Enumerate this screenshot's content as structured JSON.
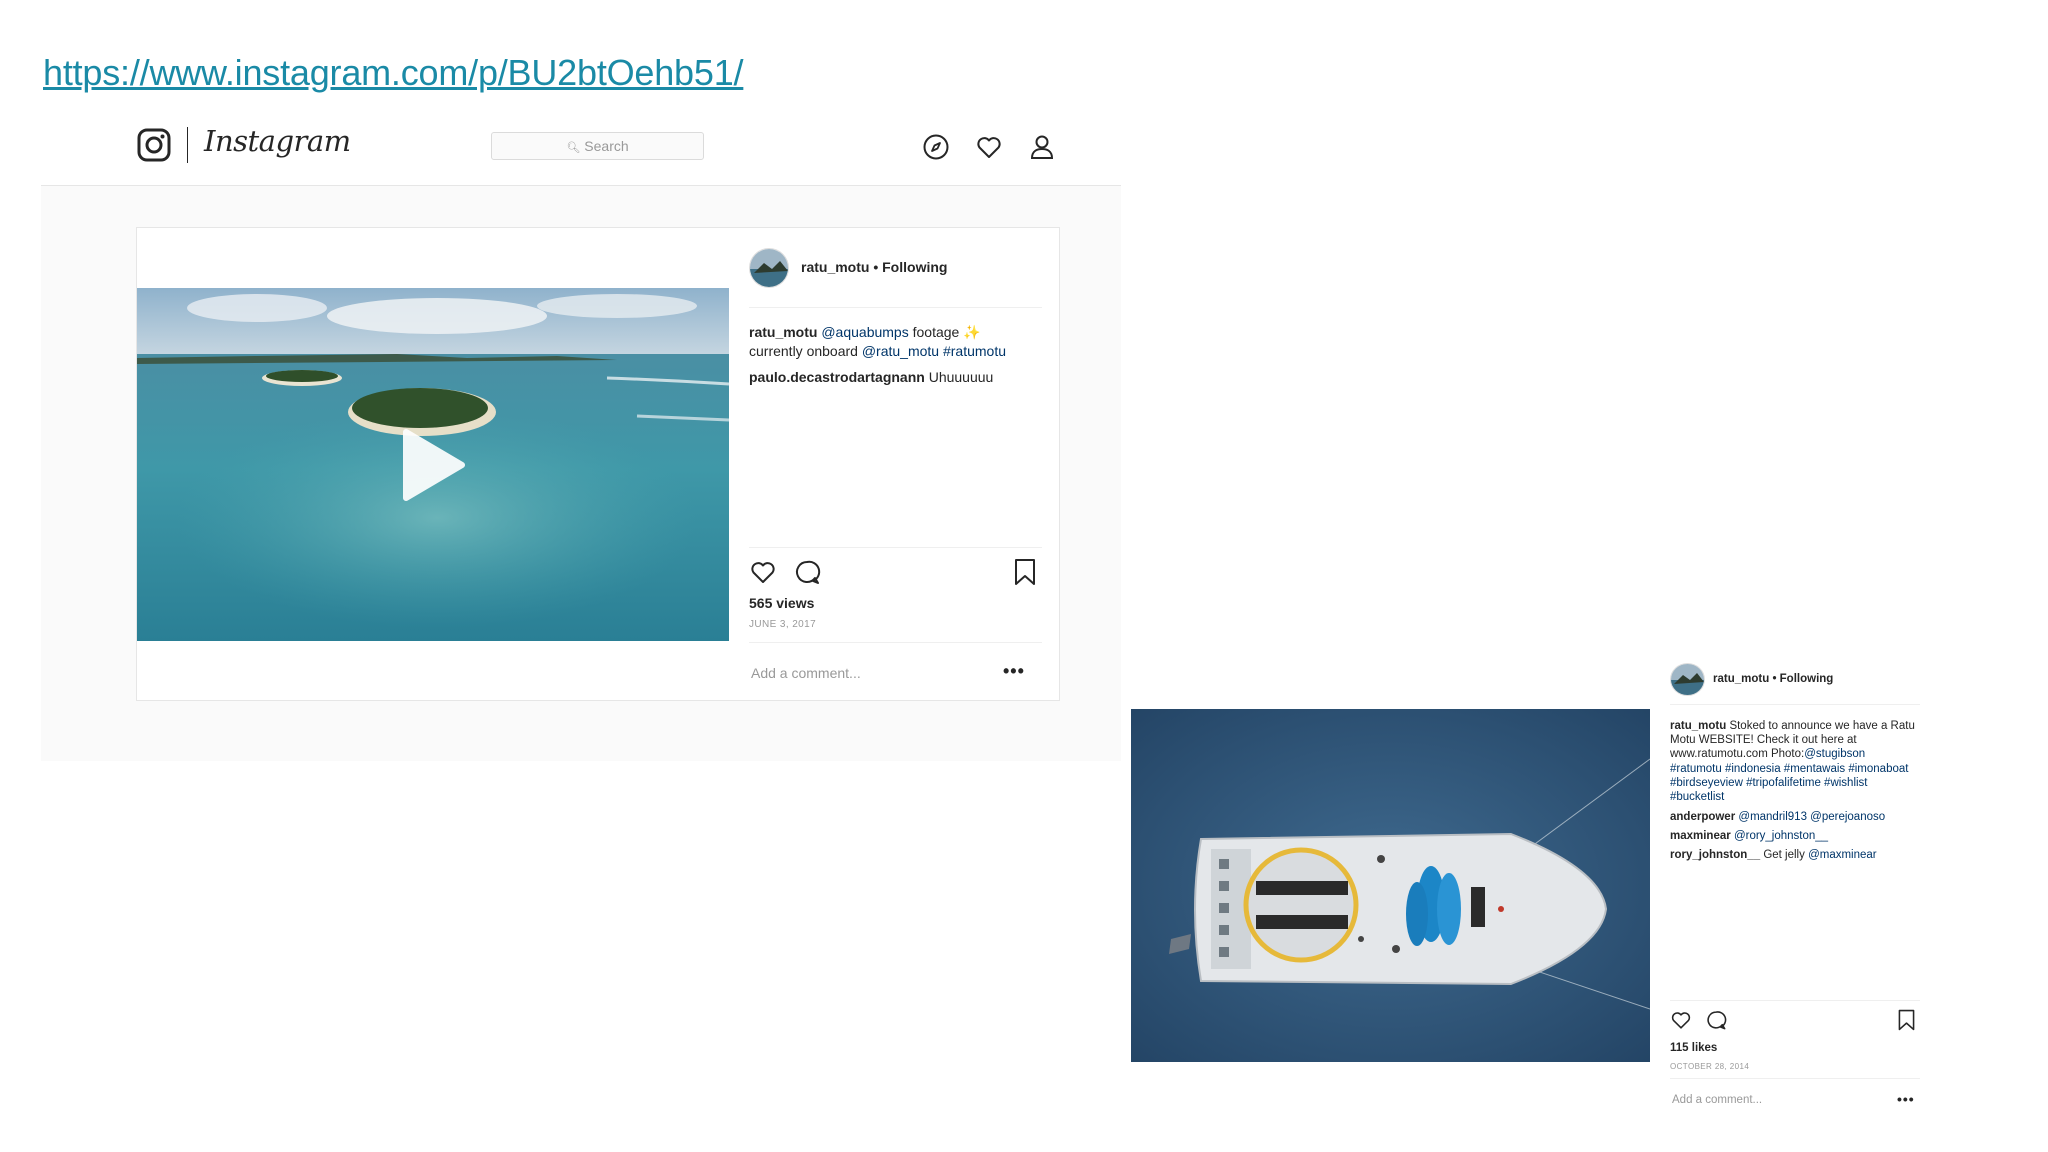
{
  "url": "https://www.instagram.com/p/BU2btOehb51/",
  "header": {
    "wordmark": "Instagram",
    "search_placeholder": "Search"
  },
  "post1": {
    "username": "ratu_motu",
    "follow_status": "• Following",
    "caption_user": "ratu_motu",
    "caption_parts": [
      "@aquabumps",
      "footage ✨",
      "currently onboard",
      "@ratu_motu",
      "#ratumotu"
    ],
    "comments": [
      {
        "user": "paulo.decastrodartagnann",
        "text": "Uhuuuuuu"
      }
    ],
    "views": "565 views",
    "date": "JUNE 3, 2017",
    "add_comment": "Add a comment...",
    "more": "•••"
  },
  "post2": {
    "username": "ratu_motu",
    "follow_status": "• Following",
    "caption_user": "ratu_motu",
    "caption_text": "Stoked to announce we have a Ratu Motu WEBSITE! Check it out here at www.ratumotu.com Photo:",
    "caption_mention": "@stugibson",
    "caption_tags": "#ratumotu #indonesia #mentawais #imonaboat #birdseyeview #tripofalifetime #wishlist #bucketlist",
    "comments": [
      {
        "user": "anderpower",
        "text": "@mandril913 @perejoanoso"
      },
      {
        "user": "maxminear",
        "text": "@rory_johnston__"
      },
      {
        "user": "rory_johnston__",
        "text_plain": "Get jelly",
        "text_mention": "@maxminear"
      }
    ],
    "likes": "115 likes",
    "date": "OCTOBER 28, 2014",
    "add_comment": "Add a comment...",
    "more": "•••"
  },
  "colors": {
    "link": "#1a8aa6",
    "mention": "#003569",
    "text": "#262626",
    "muted": "#999999"
  }
}
